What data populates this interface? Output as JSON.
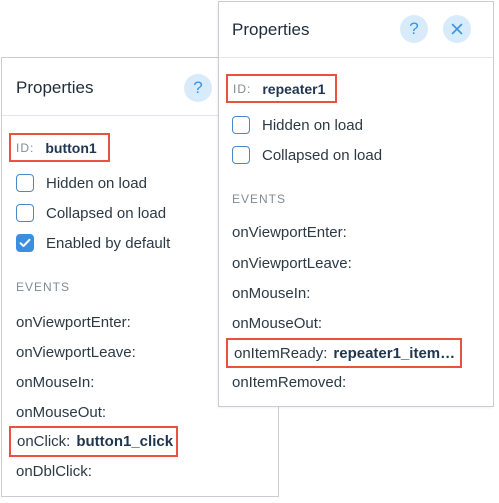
{
  "panels": {
    "button": {
      "title": "Properties",
      "help_icon": "question-icon",
      "id_label": "ID:",
      "id_value": "button1",
      "options": [
        {
          "label": "Hidden on load",
          "checked": false
        },
        {
          "label": "Collapsed on load",
          "checked": false
        },
        {
          "label": "Enabled by default",
          "checked": true
        }
      ],
      "events_heading": "EVENTS",
      "events": [
        {
          "name": "onViewportEnter:"
        },
        {
          "name": "onViewportLeave:"
        },
        {
          "name": "onMouseIn:"
        },
        {
          "name": "onMouseOut:"
        },
        {
          "name": "onClick:",
          "handler": "button1_click"
        },
        {
          "name": "onDblClick:"
        }
      ]
    },
    "repeater": {
      "title": "Properties",
      "help_icon": "question-icon",
      "close_icon": "close-icon",
      "id_label": "ID:",
      "id_value": "repeater1",
      "options": [
        {
          "label": "Hidden on load",
          "checked": false
        },
        {
          "label": "Collapsed on load",
          "checked": false
        }
      ],
      "events_heading": "EVENTS",
      "events": [
        {
          "name": "onViewportEnter:"
        },
        {
          "name": "onViewportLeave:"
        },
        {
          "name": "onMouseIn:"
        },
        {
          "name": "onMouseOut:"
        },
        {
          "name": "onItemReady:",
          "handler": "repeater1_item…"
        },
        {
          "name": "onItemRemoved:"
        }
      ]
    }
  },
  "colors": {
    "highlight": "#e8533f",
    "accent": "#3b8fe0",
    "icon_bg": "#d8ebfb"
  }
}
